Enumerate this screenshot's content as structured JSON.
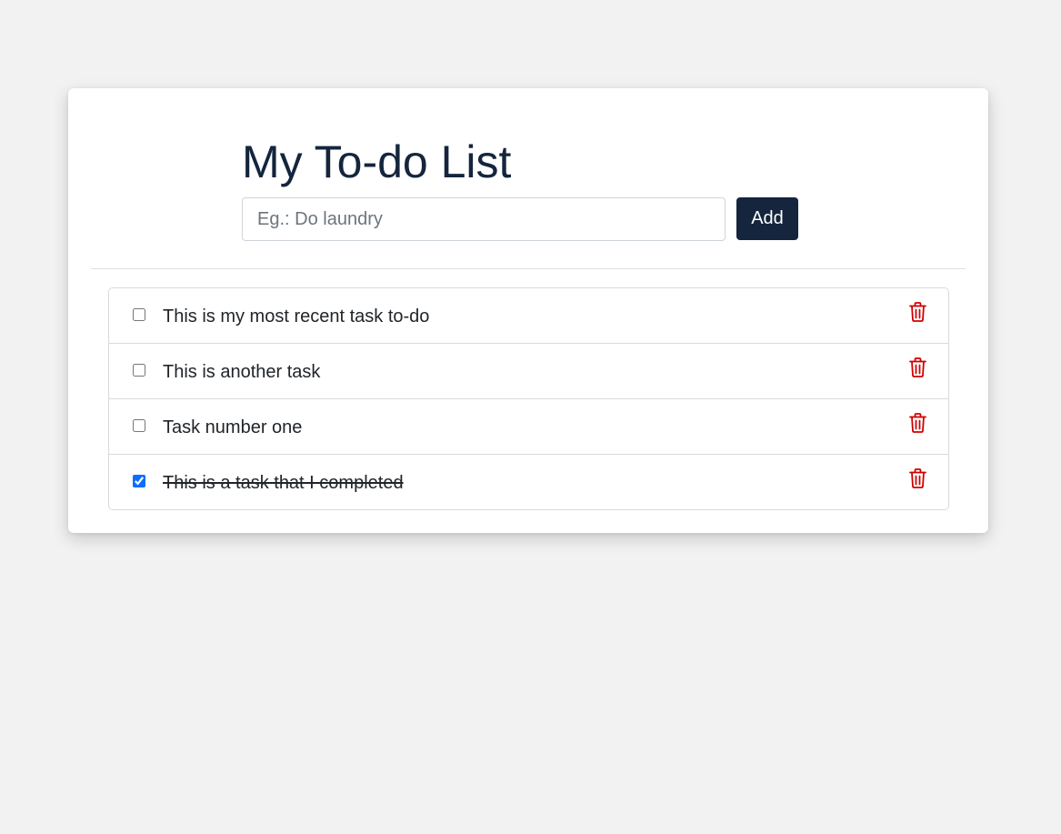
{
  "header": {
    "title": "My To-do List"
  },
  "new_task": {
    "value": "",
    "placeholder": "Eg.: Do laundry",
    "add_label": "Add"
  },
  "tasks": [
    {
      "text": "This is my most recent task to-do",
      "completed": false
    },
    {
      "text": "This is another task",
      "completed": false
    },
    {
      "text": "Task number one",
      "completed": false
    },
    {
      "text": "This is a task that I completed",
      "completed": true
    }
  ],
  "icons": {
    "delete": "trash-icon"
  },
  "colors": {
    "background": "#f2f2f2",
    "card": "#ffffff",
    "primary": "#14253d",
    "delete": "#d00000",
    "checkbox_accent": "#0d6efd"
  }
}
